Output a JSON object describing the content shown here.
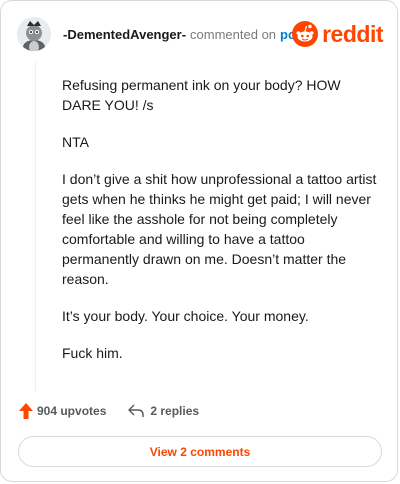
{
  "comment": {
    "author": "-DementedAvenger-",
    "action_text": "commented on",
    "post_link": "post",
    "paragraphs": [
      "Refusing permanent ink on your body? HOW DARE YOU! /s",
      "NTA",
      "I don’t give a shit how unprofessional a tattoo artist gets when he thinks he might get paid; I will never feel like the asshole for not being completely comfortable and willing to have a tattoo permanently drawn on me. Doesn’t matter the reason.",
      "It’s your body. Your choice. Your money.",
      "Fuck him."
    ]
  },
  "brand": {
    "wordmark": "reddit",
    "color": "#ff4500"
  },
  "footer": {
    "upvotes": "904 upvotes",
    "replies": "2 replies"
  },
  "view_button": {
    "label": "View 2 comments"
  },
  "icons": {
    "avatar": "user-avatar",
    "brand": "reddit-alien-icon",
    "upvote": "upvote-arrow-icon",
    "reply": "reply-arrow-icon"
  }
}
